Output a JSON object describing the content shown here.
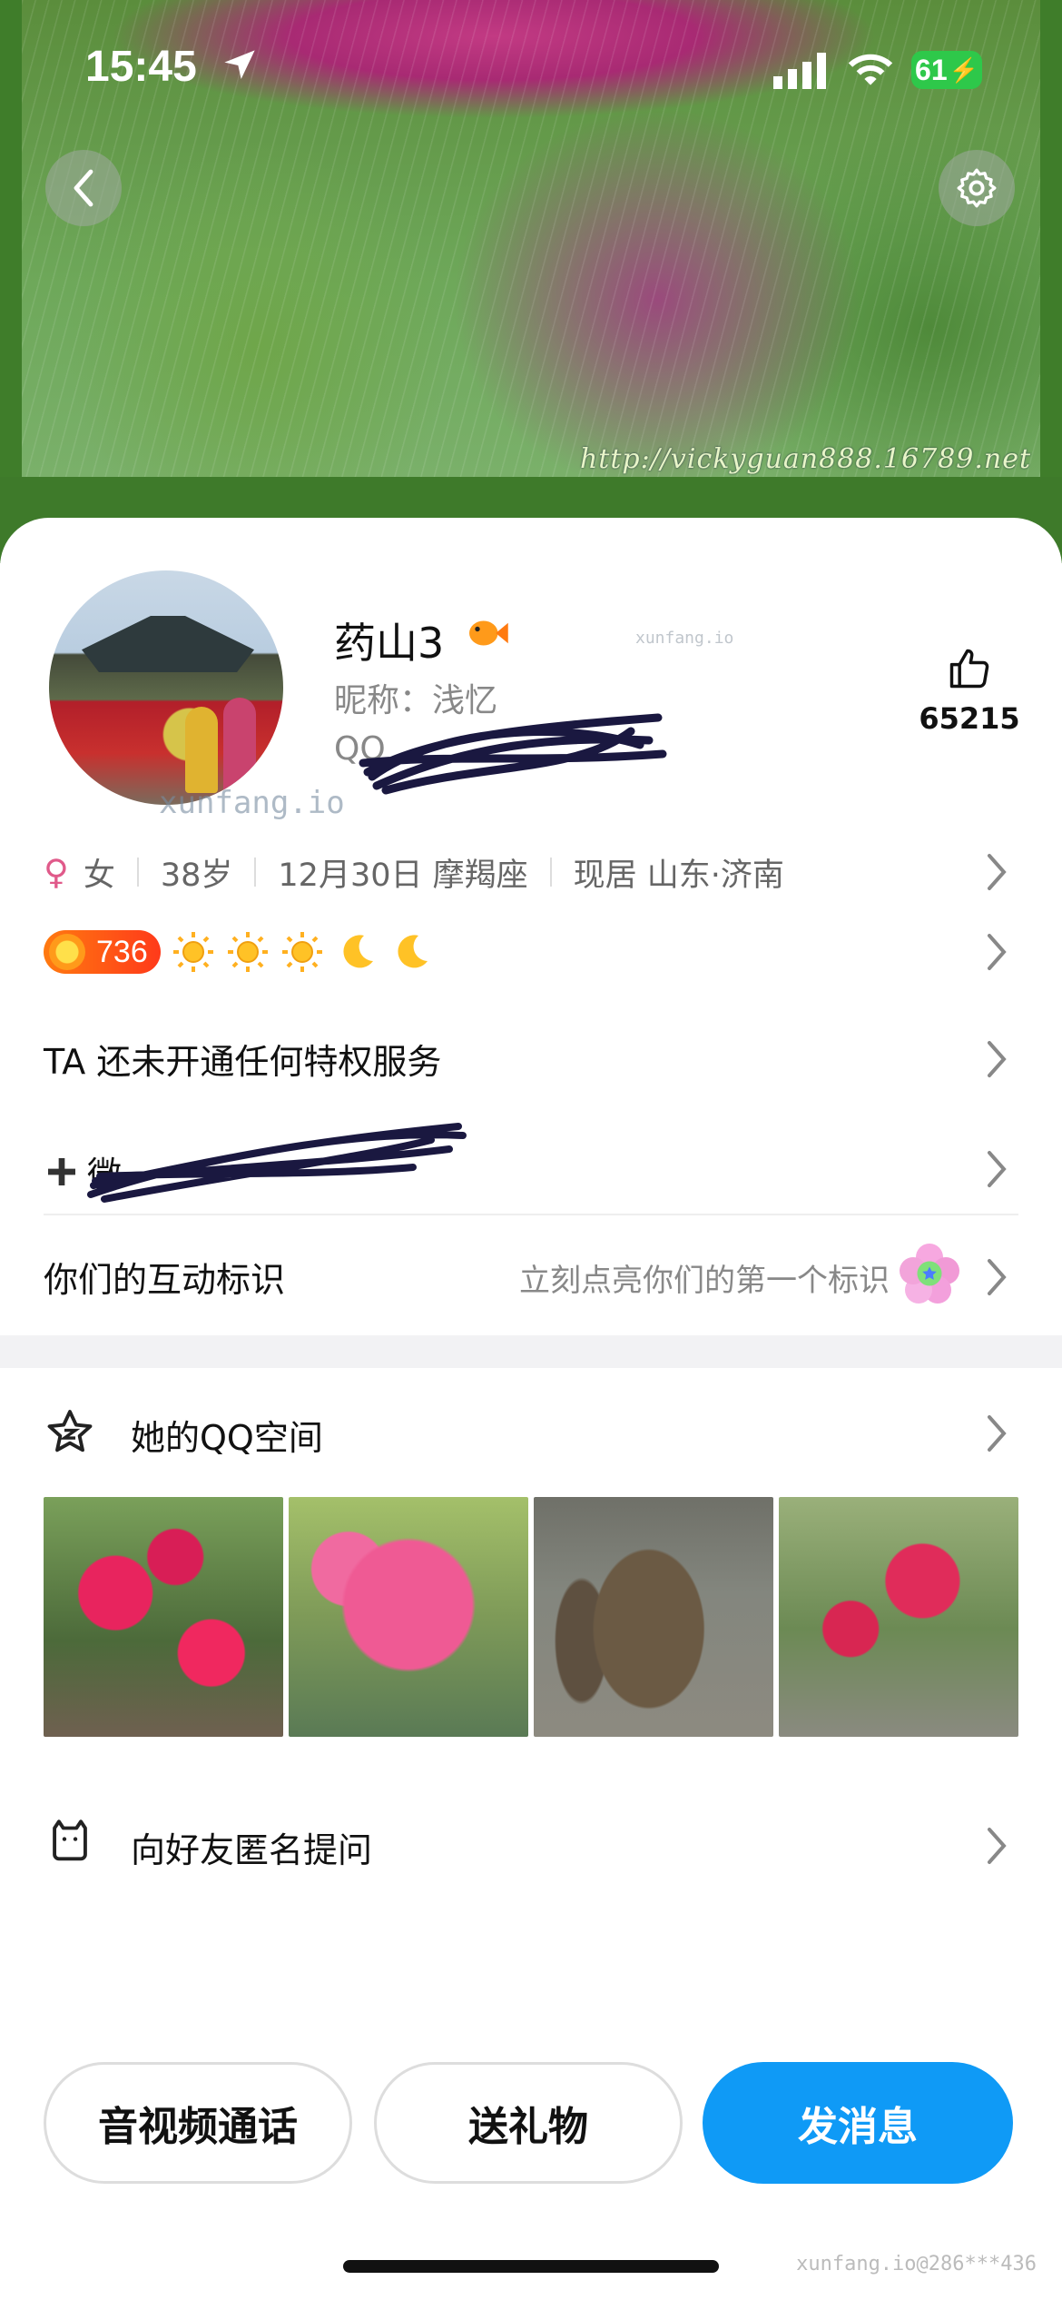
{
  "status_bar": {
    "time": "15:45",
    "battery": "61"
  },
  "hero": {
    "url_text": "http://vickyguan888.16789.net"
  },
  "profile": {
    "name": "药山3",
    "nickname": "昵称：浅忆",
    "qq_label": "QQ",
    "likes": "65215",
    "watermark": "xunfang.io"
  },
  "info": {
    "gender_symbol": "♀",
    "gender": "女",
    "age": "38岁",
    "birthday": "12月30日 摩羯座",
    "location": "现居 山东·济南"
  },
  "level": {
    "value": "736",
    "icons": [
      "sun-icon",
      "sun-icon",
      "sun-icon",
      "moon-icon",
      "moon-icon"
    ]
  },
  "rows": {
    "privilege": "TA 还未开通任何特权服务",
    "wechat_prefix": "微",
    "interaction": "你们的互动标识",
    "interaction_hint": "立刻点亮你们的第一个标识",
    "qzone": "她的QQ空间",
    "ask": "向好友匿名提问"
  },
  "buttons": {
    "call": "音视频通话",
    "gift": "送礼物",
    "message": "发消息"
  },
  "footer_watermark": "xunfang.io@286***436",
  "colors": {
    "primary": "#0f9af6",
    "level_badge": "#ff5a14"
  }
}
